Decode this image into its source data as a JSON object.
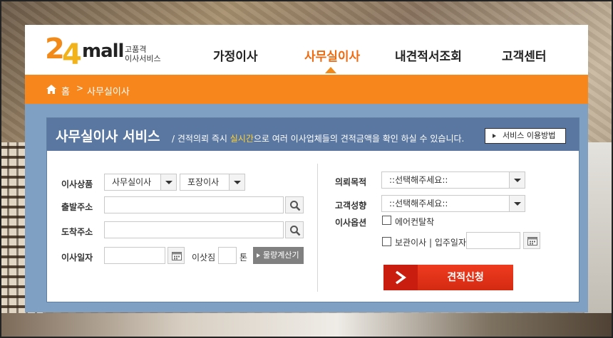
{
  "logo": {
    "num_a": "2",
    "num_b": "4",
    "brand": "mall",
    "sub_line1": "고품격",
    "sub_line2": "이사서비스"
  },
  "nav": {
    "items": [
      {
        "label": "가정이사"
      },
      {
        "label": "사무실이사"
      },
      {
        "label": "내견적서조회"
      },
      {
        "label": "고객센터"
      }
    ],
    "active": "사무실이사"
  },
  "breadcrumb": {
    "home": "홈",
    "separator": ">",
    "current": "사무실이사"
  },
  "service": {
    "title": "사무실이사 서비스",
    "desc_prefix": "/ 견적의뢰 즉시 ",
    "desc_highlight": "실시간",
    "desc_suffix": "으로 여러 이사업체들의 견적금액을 확인 하실 수 있습니다.",
    "guide_button": "서비스 이용방법"
  },
  "form_left": {
    "product_label": "이사상품",
    "product_select1": "사무실이사",
    "product_select2": "포장이사",
    "from_label": "출발주소",
    "to_label": "도착주소",
    "date_label": "이사일자",
    "load_label": "이삿짐",
    "load_unit": "톤",
    "calc_button": "물량계산기"
  },
  "form_right": {
    "purpose_label": "의뢰목적",
    "purpose_select": "::선택해주세요::",
    "tendency_label": "고객성향",
    "tendency_select": "::선택해주세요::",
    "option_label": "이사옵션",
    "option_aircon": "에어컨탈착",
    "option_storage": "보관이사 | 입주일자",
    "submit_button": "견적신청"
  },
  "colors": {
    "accent_orange": "#f7861c",
    "nav_active": "#f06a10",
    "header_blue": "#5977a0",
    "panel_blue": "#7f9fc3",
    "highlight_yellow": "#ffd233",
    "submit_red": "#e0321a"
  },
  "icons": [
    "home-icon",
    "search-icon",
    "calendar-icon",
    "chevron-right-icon",
    "play-arrow-icon"
  ]
}
